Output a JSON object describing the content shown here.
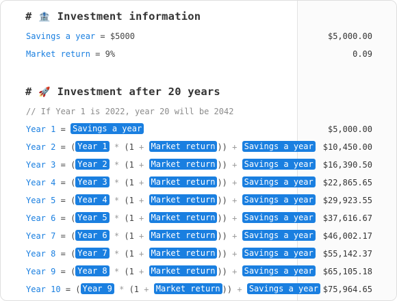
{
  "section1": {
    "title": "Investment information",
    "emoji": "🏦"
  },
  "inputs": {
    "savings_name": "Savings a year",
    "savings_expr": "$5000",
    "market_name": "Market return",
    "market_expr": "9%"
  },
  "section2": {
    "title": "Investment after 20 years",
    "emoji": "🚀",
    "comment": "// If Year 1 is 2022, year 20 will be 2042"
  },
  "year1": {
    "name": "Year 1",
    "token": "Savings a year"
  },
  "years": [
    {
      "name": "Year 2",
      "prev": "Year 1"
    },
    {
      "name": "Year 3",
      "prev": "Year 2"
    },
    {
      "name": "Year 4",
      "prev": "Year 3"
    },
    {
      "name": "Year 5",
      "prev": "Year 4"
    },
    {
      "name": "Year 6",
      "prev": "Year 5"
    },
    {
      "name": "Year 7",
      "prev": "Year 6"
    },
    {
      "name": "Year 8",
      "prev": "Year 7"
    },
    {
      "name": "Year 9",
      "prev": "Year 8"
    },
    {
      "name": "Year 10",
      "prev": "Year 9"
    }
  ],
  "formula": {
    "market": "Market return",
    "savings": "Savings a year"
  },
  "results": {
    "savings": "$5,000.00",
    "market": "0.09",
    "year1": "$5,000.00",
    "years": [
      "$10,450.00",
      "$16,390.50",
      "$22,865.65",
      "$29,923.55",
      "$37,616.67",
      "$46,002.17",
      "$55,142.37",
      "$65,105.18",
      "$75,964.65"
    ]
  },
  "colors": {
    "accent": "#1a7fe0"
  }
}
